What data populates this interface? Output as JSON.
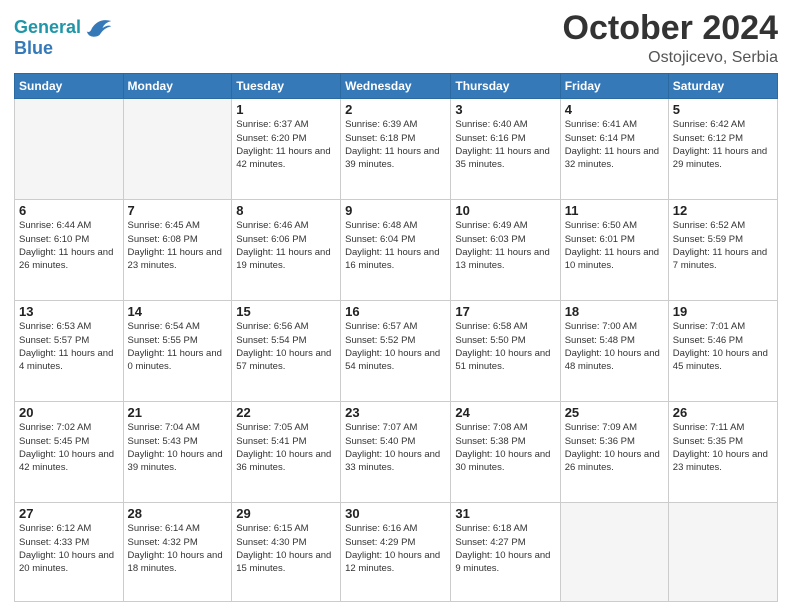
{
  "header": {
    "logo_line1": "General",
    "logo_line2": "Blue",
    "month": "October 2024",
    "location": "Ostojicevo, Serbia"
  },
  "days_of_week": [
    "Sunday",
    "Monday",
    "Tuesday",
    "Wednesday",
    "Thursday",
    "Friday",
    "Saturday"
  ],
  "weeks": [
    [
      {
        "day": "",
        "info": ""
      },
      {
        "day": "",
        "info": ""
      },
      {
        "day": "1",
        "info": "Sunrise: 6:37 AM\nSunset: 6:20 PM\nDaylight: 11 hours and 42 minutes."
      },
      {
        "day": "2",
        "info": "Sunrise: 6:39 AM\nSunset: 6:18 PM\nDaylight: 11 hours and 39 minutes."
      },
      {
        "day": "3",
        "info": "Sunrise: 6:40 AM\nSunset: 6:16 PM\nDaylight: 11 hours and 35 minutes."
      },
      {
        "day": "4",
        "info": "Sunrise: 6:41 AM\nSunset: 6:14 PM\nDaylight: 11 hours and 32 minutes."
      },
      {
        "day": "5",
        "info": "Sunrise: 6:42 AM\nSunset: 6:12 PM\nDaylight: 11 hours and 29 minutes."
      }
    ],
    [
      {
        "day": "6",
        "info": "Sunrise: 6:44 AM\nSunset: 6:10 PM\nDaylight: 11 hours and 26 minutes."
      },
      {
        "day": "7",
        "info": "Sunrise: 6:45 AM\nSunset: 6:08 PM\nDaylight: 11 hours and 23 minutes."
      },
      {
        "day": "8",
        "info": "Sunrise: 6:46 AM\nSunset: 6:06 PM\nDaylight: 11 hours and 19 minutes."
      },
      {
        "day": "9",
        "info": "Sunrise: 6:48 AM\nSunset: 6:04 PM\nDaylight: 11 hours and 16 minutes."
      },
      {
        "day": "10",
        "info": "Sunrise: 6:49 AM\nSunset: 6:03 PM\nDaylight: 11 hours and 13 minutes."
      },
      {
        "day": "11",
        "info": "Sunrise: 6:50 AM\nSunset: 6:01 PM\nDaylight: 11 hours and 10 minutes."
      },
      {
        "day": "12",
        "info": "Sunrise: 6:52 AM\nSunset: 5:59 PM\nDaylight: 11 hours and 7 minutes."
      }
    ],
    [
      {
        "day": "13",
        "info": "Sunrise: 6:53 AM\nSunset: 5:57 PM\nDaylight: 11 hours and 4 minutes."
      },
      {
        "day": "14",
        "info": "Sunrise: 6:54 AM\nSunset: 5:55 PM\nDaylight: 11 hours and 0 minutes."
      },
      {
        "day": "15",
        "info": "Sunrise: 6:56 AM\nSunset: 5:54 PM\nDaylight: 10 hours and 57 minutes."
      },
      {
        "day": "16",
        "info": "Sunrise: 6:57 AM\nSunset: 5:52 PM\nDaylight: 10 hours and 54 minutes."
      },
      {
        "day": "17",
        "info": "Sunrise: 6:58 AM\nSunset: 5:50 PM\nDaylight: 10 hours and 51 minutes."
      },
      {
        "day": "18",
        "info": "Sunrise: 7:00 AM\nSunset: 5:48 PM\nDaylight: 10 hours and 48 minutes."
      },
      {
        "day": "19",
        "info": "Sunrise: 7:01 AM\nSunset: 5:46 PM\nDaylight: 10 hours and 45 minutes."
      }
    ],
    [
      {
        "day": "20",
        "info": "Sunrise: 7:02 AM\nSunset: 5:45 PM\nDaylight: 10 hours and 42 minutes."
      },
      {
        "day": "21",
        "info": "Sunrise: 7:04 AM\nSunset: 5:43 PM\nDaylight: 10 hours and 39 minutes."
      },
      {
        "day": "22",
        "info": "Sunrise: 7:05 AM\nSunset: 5:41 PM\nDaylight: 10 hours and 36 minutes."
      },
      {
        "day": "23",
        "info": "Sunrise: 7:07 AM\nSunset: 5:40 PM\nDaylight: 10 hours and 33 minutes."
      },
      {
        "day": "24",
        "info": "Sunrise: 7:08 AM\nSunset: 5:38 PM\nDaylight: 10 hours and 30 minutes."
      },
      {
        "day": "25",
        "info": "Sunrise: 7:09 AM\nSunset: 5:36 PM\nDaylight: 10 hours and 26 minutes."
      },
      {
        "day": "26",
        "info": "Sunrise: 7:11 AM\nSunset: 5:35 PM\nDaylight: 10 hours and 23 minutes."
      }
    ],
    [
      {
        "day": "27",
        "info": "Sunrise: 6:12 AM\nSunset: 4:33 PM\nDaylight: 10 hours and 20 minutes."
      },
      {
        "day": "28",
        "info": "Sunrise: 6:14 AM\nSunset: 4:32 PM\nDaylight: 10 hours and 18 minutes."
      },
      {
        "day": "29",
        "info": "Sunrise: 6:15 AM\nSunset: 4:30 PM\nDaylight: 10 hours and 15 minutes."
      },
      {
        "day": "30",
        "info": "Sunrise: 6:16 AM\nSunset: 4:29 PM\nDaylight: 10 hours and 12 minutes."
      },
      {
        "day": "31",
        "info": "Sunrise: 6:18 AM\nSunset: 4:27 PM\nDaylight: 10 hours and 9 minutes."
      },
      {
        "day": "",
        "info": ""
      },
      {
        "day": "",
        "info": ""
      }
    ]
  ]
}
